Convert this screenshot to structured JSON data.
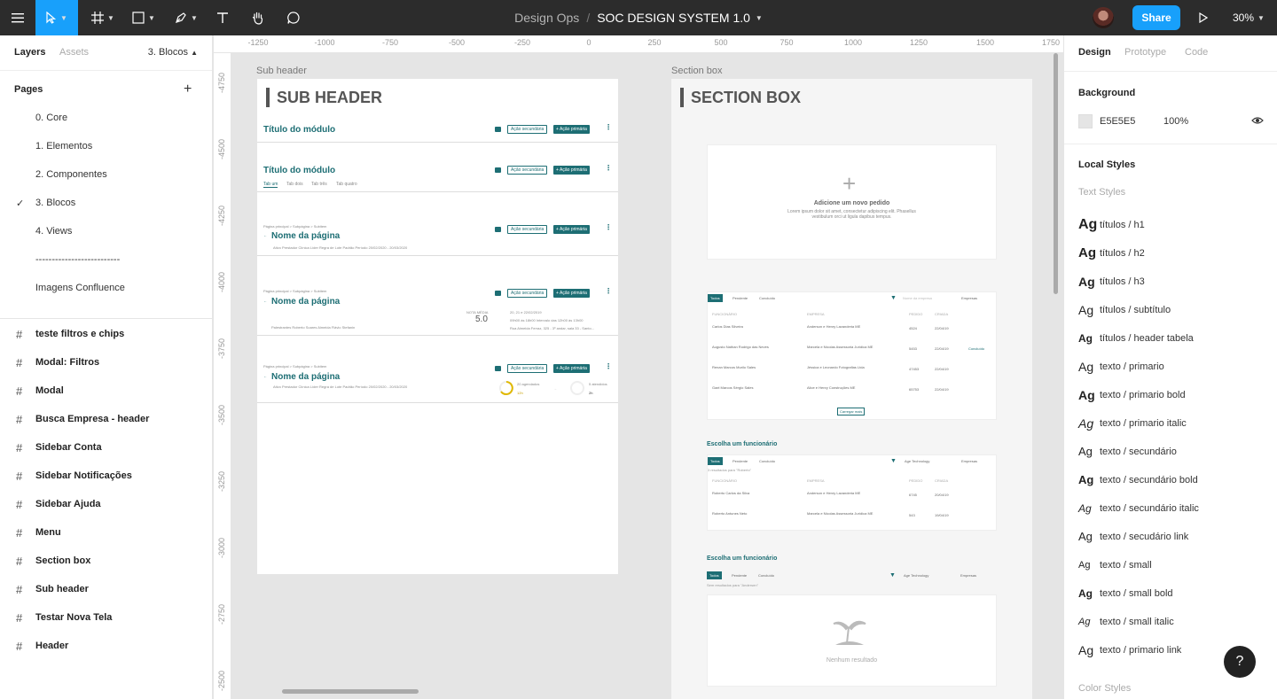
{
  "toolbar": {
    "project": "Design Ops",
    "separator": "/",
    "file": "SOC DESIGN SYSTEM 1.0",
    "share_label": "Share",
    "zoom": "30%"
  },
  "left_panel": {
    "tabs": [
      "Layers",
      "Assets"
    ],
    "page_selector": "3. Blocos",
    "pages_header": "Pages",
    "pages": [
      "0. Core",
      "1. Elementos",
      "2. Componentes",
      "3. Blocos",
      "4. Views",
      "--------------------------",
      "Imagens Confluence"
    ],
    "selected_page": "3. Blocos",
    "layers": [
      "teste filtros e chips",
      "Modal: Filtros",
      "Modal",
      "Busca Empresa - header",
      "Sidebar Conta",
      "Sidebar Notificações",
      "Sidebar Ajuda",
      "Menu",
      "Section box",
      "Sub header",
      "Testar Nova Tela",
      "Header"
    ]
  },
  "ruler": {
    "top": [
      "-1250",
      "-1000",
      "-750",
      "-500",
      "-250",
      "0",
      "250",
      "500",
      "750",
      "1000",
      "1250",
      "1500",
      "1750"
    ],
    "left": [
      "-4750",
      "-4500",
      "-4250",
      "-4000",
      "-3750",
      "-3500",
      "-3250",
      "-3000",
      "-2750",
      "-2500"
    ]
  },
  "canvas": {
    "sub_header": {
      "label": "Sub header",
      "title": "SUB HEADER",
      "module_title": "Título do módulo",
      "btn_secondary": "Ação secundária",
      "btn_primary": "+ Ação primária",
      "tabs": [
        "Tab um",
        "Tab dois",
        "Tab três",
        "Tab quatro"
      ],
      "breadcrumb": "Página principal  >  Subpágina  >  Subitem",
      "page_name": "Nome da página",
      "meta_line": "Ativo   Prestador Clínica Líder   Regra de Lote Padrão   Período 20/02/2020 - 20/03/2020",
      "rating": "5.0",
      "rating_label": "NOTA MÉDIA",
      "date_line": "20, 21 e 22/02/2019",
      "time_line": "09h00 às 18h00 Intervalo das 12h00 às 13h00",
      "address_line": "Rua Almeida Ferraz, 325 - 3º andar, sala 33 - Santo...",
      "speakers": "Palestrantes   Roberto Soares Almeida   Flávio Stefanin",
      "stat_a": "20 agendados",
      "stat_b": "12h",
      "stat_c": "5 atendidos",
      "stat_d": "2h"
    },
    "section_box": {
      "label": "Section box",
      "title": "SECTION BOX",
      "add_title": "Adicione um novo pedido",
      "add_desc": "Lorem ipsum dolor sit amet, consectetur adipiscing elit. Phasellus vestibulum orci ut ligula dapibus tempus.",
      "tabs": [
        "Todos",
        "Pendente",
        "Concluído"
      ],
      "search_placeholder": "Nome da empresa",
      "companies_label": "Empresas",
      "columns": [
        "FUNCIONÁRIO",
        "EMPRESA",
        "PEDIDO",
        "CRIADA"
      ],
      "rows": [
        [
          "Carlos Dias Silveira",
          "Anderson e Henry Lavanderia ME",
          "4524",
          "22/04/19"
        ],
        [
          "Augusto Nathan Rodrigo das Neves",
          "Marcela e Nicolas Assessoria Jurídica ME",
          "5453",
          "22/04/19"
        ],
        [
          "Renan Marcos Murilo Sales",
          "Jéssica e Leonardo Fotografias Ltda",
          "47453",
          "22/04/19"
        ],
        [
          "Gael Marcos Sérgio Sales",
          "Alice e Henry Construções ME",
          "65753",
          "22/04/19"
        ]
      ],
      "row_action": "Concluído",
      "load_more": "Carregar mais",
      "choose_title": "Escolha um funcionário",
      "filter_value": "Age Technology",
      "results_hint": "3 resultados para \"Roberto\"",
      "rows2": [
        [
          "Roberto Carlos da Silva",
          "Anderson e Henry Lavanderia ME",
          "6745",
          "20/04/19"
        ],
        [
          "Roberto Antunes Neto",
          "Marcela e Nicolas Assessoria Jurídica ME",
          "543",
          "19/04/19"
        ]
      ],
      "empty_hint": "Sem resultados para \"Andersen\"",
      "empty_label": "Nenhum resultado"
    }
  },
  "right_panel": {
    "tabs": [
      "Design",
      "Prototype",
      "Code"
    ],
    "background_label": "Background",
    "bg_hex": "E5E5E5",
    "bg_opacity": "100%",
    "local_styles": "Local Styles",
    "text_styles": "Text Styles",
    "styles": [
      {
        "label": "títulos / h1",
        "size": 16,
        "weight": "bold",
        "italic": false
      },
      {
        "label": "títulos / h2",
        "size": 15,
        "weight": "bold",
        "italic": false
      },
      {
        "label": "títulos / h3",
        "size": 14,
        "weight": "bold",
        "italic": false
      },
      {
        "label": "títulos / subtítulo",
        "size": 14,
        "weight": "normal",
        "italic": false
      },
      {
        "label": "títulos / header tabela",
        "size": 12,
        "weight": "bold",
        "italic": false
      },
      {
        "label": "texto / primario",
        "size": 14,
        "weight": "normal",
        "italic": false
      },
      {
        "label": "texto / primario bold",
        "size": 14,
        "weight": "bold",
        "italic": false
      },
      {
        "label": "texto / primario italic",
        "size": 14,
        "weight": "normal",
        "italic": true
      },
      {
        "label": "texto / secundário",
        "size": 13,
        "weight": "normal",
        "italic": false
      },
      {
        "label": "texto / secundário bold",
        "size": 13,
        "weight": "bold",
        "italic": false
      },
      {
        "label": "texto / secundário italic",
        "size": 12,
        "weight": "normal",
        "italic": true
      },
      {
        "label": "texto / secudário link",
        "size": 13,
        "weight": "normal",
        "italic": false
      },
      {
        "label": "texto / small",
        "size": 11,
        "weight": "normal",
        "italic": false
      },
      {
        "label": "texto / small bold",
        "size": 12,
        "weight": "bold",
        "italic": false
      },
      {
        "label": "texto / small italic",
        "size": 11,
        "weight": "normal",
        "italic": true
      },
      {
        "label": "texto / primario link",
        "size": 14,
        "weight": "normal",
        "italic": false
      }
    ],
    "ag_glyph": "Ag",
    "color_styles": "Color Styles",
    "help_label": "?"
  },
  "colors": {
    "toolbar_bg": "#2c2c2c",
    "accent": "#18a0fb",
    "teal": "#1d6e74",
    "canvas_bg": "#e5e5e5"
  }
}
